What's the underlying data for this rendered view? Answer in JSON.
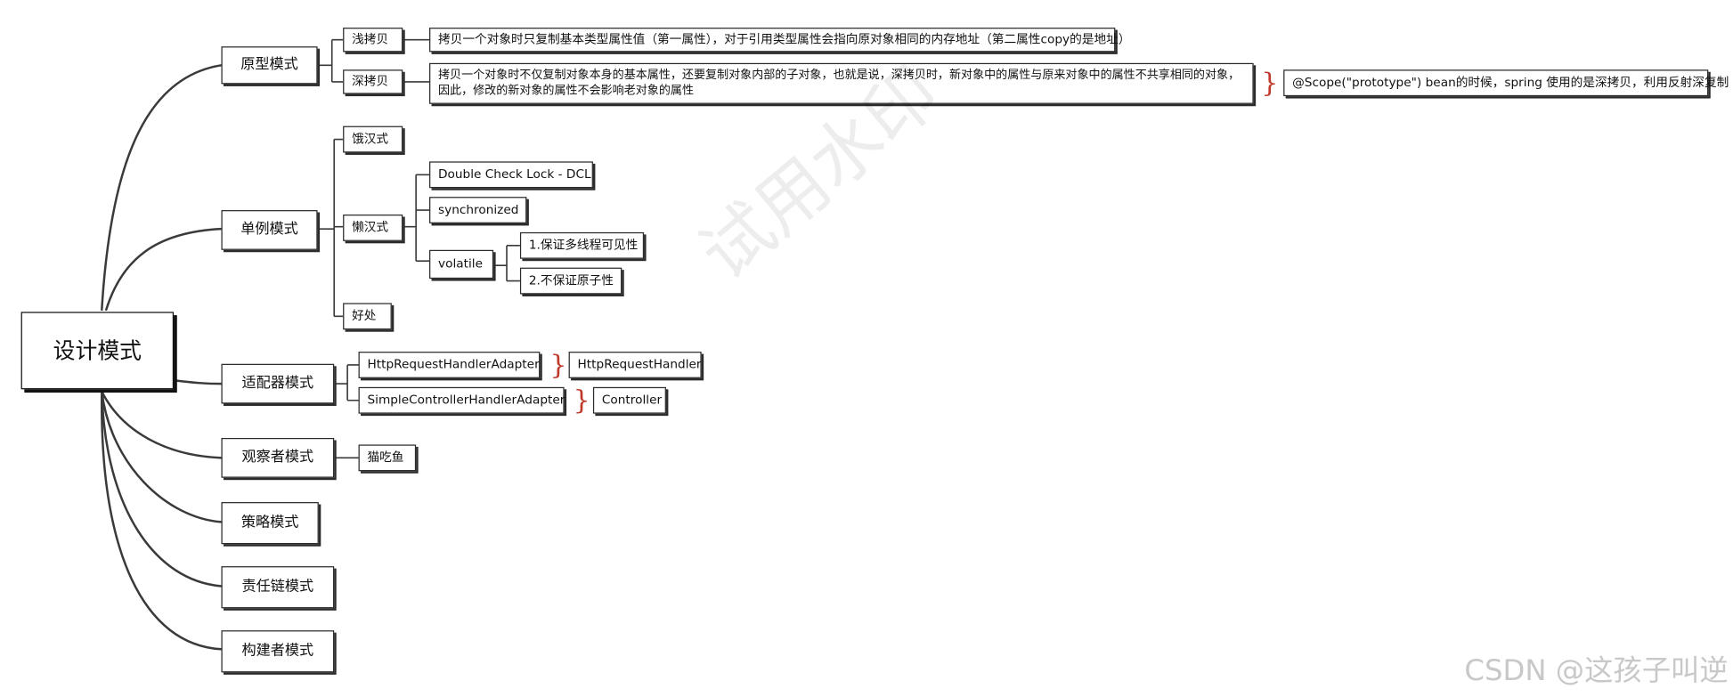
{
  "root": {
    "label": "设计模式"
  },
  "branches": {
    "prototype": {
      "label": "原型模式",
      "shallow": {
        "label": "浅拷贝",
        "desc": "拷贝一个对象时只复制基本类型属性值（第一属性），对于引用类型属性会指向原对象相同的内存地址（第二属性copy的是地址）"
      },
      "deep": {
        "label": "深拷贝",
        "desc": "拷贝一个对象时不仅复制对象本身的基本属性，还要复制对象内部的子对象，也就是说，深拷贝时，新对象中的属性与原来对象中的属性不共享相同的对象，因此，修改的新对象的属性不会影响老对象的属性",
        "note": "@Scope(\"prototype\") bean的时候，spring 使用的是深拷贝，利用反射深复制"
      }
    },
    "singleton": {
      "label": "单例模式",
      "eager": {
        "label": "饿汉式"
      },
      "lazy": {
        "label": "懒汉式",
        "dcl": "Double Check Lock - DCL",
        "sync": "synchronized",
        "volatile": {
          "label": "volatile",
          "point1": "1.保证多线程可见性",
          "point2": "2.不保证原子性"
        }
      },
      "benefit": {
        "label": "好处"
      }
    },
    "adapter": {
      "label": "适配器模式",
      "items": [
        {
          "label": "HttpRequestHandlerAdapter",
          "target": "HttpRequestHandler"
        },
        {
          "label": "SimpleControllerHandlerAdapter",
          "target": "Controller"
        }
      ]
    },
    "observer": {
      "label": "观察者模式",
      "example": "猫吃鱼"
    },
    "strategy": {
      "label": "策略模式"
    },
    "chain": {
      "label": "责任链模式"
    },
    "builder": {
      "label": "构建者模式"
    }
  },
  "watermark": {
    "center": "试用水印",
    "corner": "CSDN @这孩子叫逆"
  },
  "colors": {
    "line": "#3a3a3a",
    "brace": "#c0392b"
  }
}
